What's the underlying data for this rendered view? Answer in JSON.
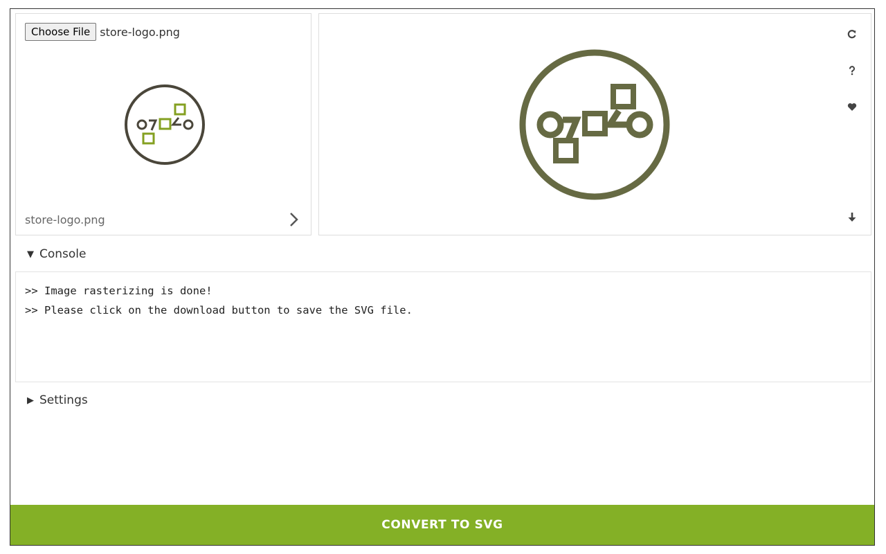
{
  "uploader": {
    "choose_button_label": "Choose File",
    "selected_file": "store-logo.png",
    "thumbnail_caption": "store-logo.png"
  },
  "preview_tools": {
    "icons": [
      "refresh-icon",
      "help-icon",
      "heart-icon",
      "download-icon"
    ]
  },
  "console": {
    "label": "Console",
    "expanded": true,
    "lines": [
      ">> Image rasterizing is done!",
      ">> Please click on the download button to save the SVG file."
    ]
  },
  "settings": {
    "label": "Settings",
    "expanded": false
  },
  "convert_button_label": "CONVERT TO SVG",
  "colors": {
    "accent_green": "#84b026",
    "logo_dark": "#4a463a",
    "logo_green": "#84a021",
    "vector_olive": "#666a43"
  }
}
